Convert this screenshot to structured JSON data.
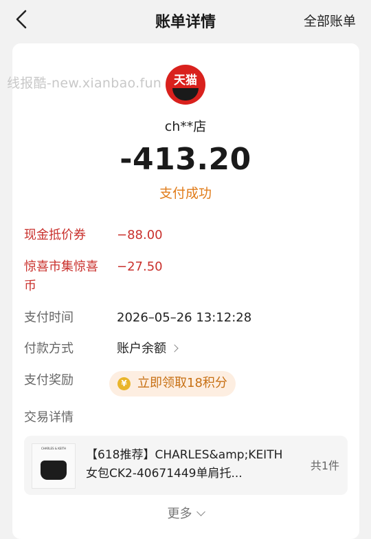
{
  "header": {
    "title": "账单详情",
    "all_bills_label": "全部账单"
  },
  "watermark": "线报酷-new.xianbao.fun",
  "merchant": {
    "logo_text": "天猫",
    "name": "ch**店"
  },
  "amount": "-413.20",
  "status": "支付成功",
  "rows": {
    "coupon": {
      "label": "现金抵价券",
      "value": "−88.00"
    },
    "surprise": {
      "label": "惊喜市集惊喜币",
      "value": "−27.50"
    },
    "pay_time": {
      "label": "支付时间",
      "value": "2026–05–26 13:12:28"
    },
    "pay_method": {
      "label": "付款方式",
      "value": "账户余额"
    },
    "reward": {
      "label": "支付奖励",
      "value": "立即领取18积分",
      "coin_glyph": "¥"
    },
    "detail": {
      "label": "交易详情"
    }
  },
  "product": {
    "brand": "CHARLES & KEITH",
    "title": "【618推荐】CHARLES&amp;KEITH女包CK2-40671449单肩托...",
    "quantity": "共1件"
  },
  "more_label": "更多",
  "colors": {
    "accent": "#e07b19",
    "red": "#c9302c",
    "tmall": "#d9211d"
  }
}
